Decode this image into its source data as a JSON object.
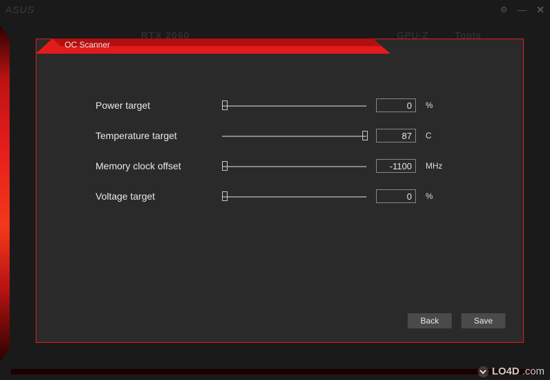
{
  "titlebar": {
    "logo_text": "ASUS"
  },
  "background": {
    "gpu_model": "RTX 2060",
    "tab_gpuz": "GPU-Z",
    "tab_tools": "Tools"
  },
  "panel": {
    "title": "OC Scanner",
    "rows": [
      {
        "label": "Power target",
        "value": "0",
        "unit": "%",
        "thumb_pct": 0
      },
      {
        "label": "Temperature target",
        "value": "87",
        "unit": "C",
        "thumb_pct": 97
      },
      {
        "label": "Memory clock offset",
        "value": "-1100",
        "unit": "MHz",
        "thumb_pct": 0
      },
      {
        "label": "Voltage target",
        "value": "0",
        "unit": "%",
        "thumb_pct": 0
      }
    ],
    "buttons": {
      "back": "Back",
      "save": "Save"
    }
  },
  "watermark": {
    "site": "LO4D",
    "tld": ".com"
  }
}
